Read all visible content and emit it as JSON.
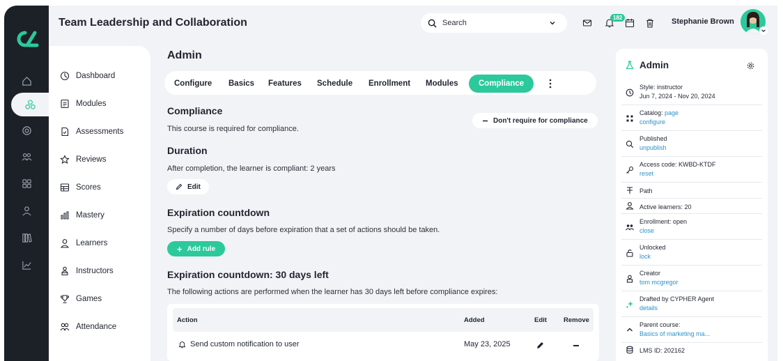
{
  "colors": {
    "accent": "#2bc99b",
    "rail": "#1c2128",
    "link": "#2a93c9",
    "bg": "#f2f3f6"
  },
  "header": {
    "title": "Team Leadership and Collaboration",
    "search_placeholder": "Search",
    "notification_count": "182",
    "user_name": "Stephanie Brown"
  },
  "rail": {
    "items": [
      "home-icon",
      "modules-icon",
      "target-icon",
      "users-icon",
      "grid-icon",
      "user-icon",
      "library-icon",
      "chart-icon"
    ]
  },
  "subnav": {
    "items": [
      {
        "label": "Dashboard",
        "icon": "dashboard-icon"
      },
      {
        "label": "Modules",
        "icon": "modules-icon"
      },
      {
        "label": "Assessments",
        "icon": "assessment-icon"
      },
      {
        "label": "Reviews",
        "icon": "star-icon"
      },
      {
        "label": "Scores",
        "icon": "table-icon"
      },
      {
        "label": "Mastery",
        "icon": "bar-chart-icon"
      },
      {
        "label": "Learners",
        "icon": "user-icon"
      },
      {
        "label": "Instructors",
        "icon": "instructor-icon"
      },
      {
        "label": "Games",
        "icon": "trophy-icon"
      },
      {
        "label": "Attendance",
        "icon": "group-icon"
      }
    ]
  },
  "main": {
    "heading": "Admin",
    "tabs": [
      "Configure",
      "Basics",
      "Features",
      "Schedule",
      "Enrollment",
      "Modules",
      "Compliance"
    ],
    "active_tab": "Compliance",
    "compliance": {
      "title": "Compliance",
      "text": "This course is required for compliance.",
      "button": "Don't require for compliance"
    },
    "duration": {
      "title": "Duration",
      "text": "After completion, the learner is compliant: 2 years",
      "edit": "Edit"
    },
    "expiration": {
      "title": "Expiration countdown",
      "text": "Specify a number of days before expiration that a set of actions should be taken.",
      "add_rule": "Add rule"
    },
    "countdown": {
      "title": "Expiration countdown: 30 days left",
      "text": "The following actions are performed when the learner has 30 days left before compliance expires:",
      "columns": [
        "Action",
        "Added",
        "Edit",
        "Remove"
      ],
      "rows": [
        {
          "action": "Send custom notification to user",
          "added": "May 23, 2025"
        }
      ]
    }
  },
  "panel": {
    "title": "Admin",
    "rows": [
      {
        "icon": "clock-icon",
        "l1": "Style: instructor",
        "l2": "Jun 7, 2024 - Nov 20, 2024",
        "l2_dark": true
      },
      {
        "icon": "catalog-icon",
        "l1": "Catalog: ",
        "l1_link": "page",
        "l2": "configure"
      },
      {
        "icon": "search-icon",
        "l1": "Published",
        "l2": "unpublish"
      },
      {
        "icon": "key-icon",
        "l1": "Access code: KWBD-KTDF",
        "l2": "reset"
      },
      {
        "icon": "path-icon",
        "l1": "Path"
      },
      {
        "icon": "user-icon",
        "l1": "Active learners: 20"
      },
      {
        "icon": "enroll-icon",
        "l1": "Enrollment: open",
        "l2": "close"
      },
      {
        "icon": "unlock-icon",
        "l1": "Unlocked",
        "l2": "lock"
      },
      {
        "icon": "creator-icon",
        "l1": "Creator",
        "l2": "tom mcgregor"
      },
      {
        "icon": "sparkle-icon",
        "l1": "Drafted by CYPHER Agent",
        "l2": "details"
      },
      {
        "icon": "chevron-up-icon",
        "l1": "Parent course:",
        "l2": "Basics of marketing ma..."
      },
      {
        "icon": "database-icon",
        "l1": "LMS ID: 202162"
      }
    ]
  }
}
